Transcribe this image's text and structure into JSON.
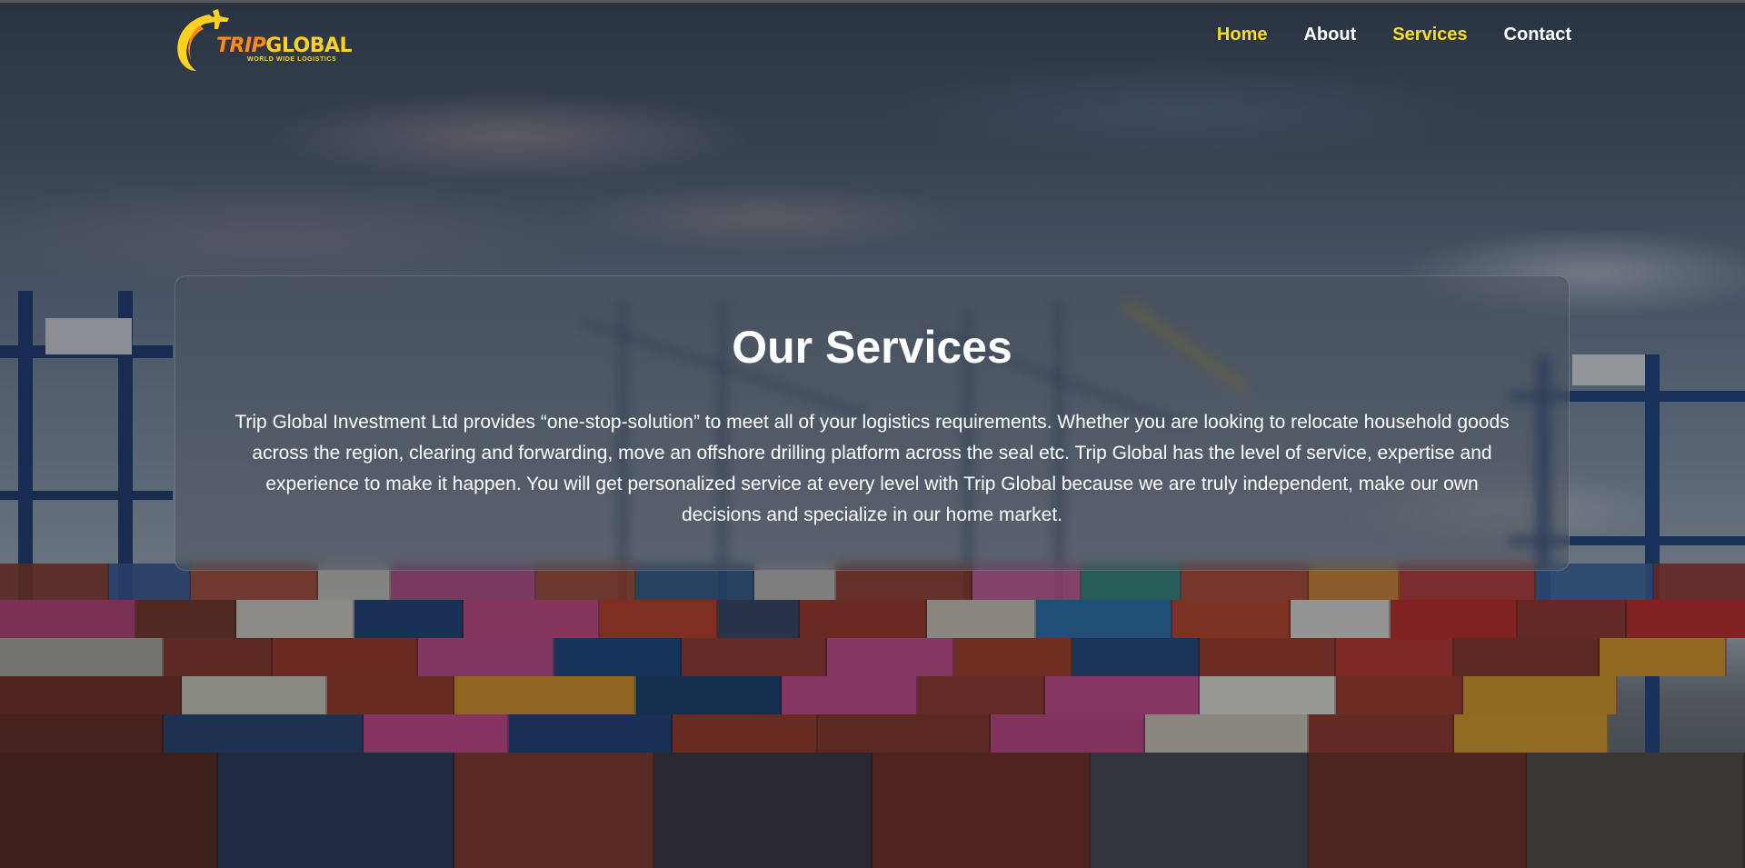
{
  "header": {
    "logo": {
      "name": "TRIPGLOBAL",
      "name_part1": "TRIP",
      "name_part2": "GLOBAL",
      "tagline": "WORLD WIDE LOGISTICS"
    },
    "nav": [
      {
        "label": "Home",
        "state": "active"
      },
      {
        "label": "About",
        "state": "default"
      },
      {
        "label": "Services",
        "state": "highlight"
      },
      {
        "label": "Contact",
        "state": "default"
      }
    ]
  },
  "main": {
    "title": "Our Services",
    "description": "Trip Global Investment Ltd provides “one-stop-solution” to meet all of your logistics requirements. Whether you are looking to relocate household goods across the region, clearing and forwarding, move an offshore drilling platform across the seal etc. Trip Global has the level of service, expertise and experience to make it happen. You will get personalized service at every level with Trip Global because we are truly independent, make our own decisions and specialize in our home market."
  },
  "colors": {
    "accent": "#ffdd1f",
    "logo_orange": "#ff8a1c",
    "text": "#ffffff",
    "overlay": "#4b525c"
  },
  "icons": {
    "logo": "airplane-swoosh-icon"
  }
}
